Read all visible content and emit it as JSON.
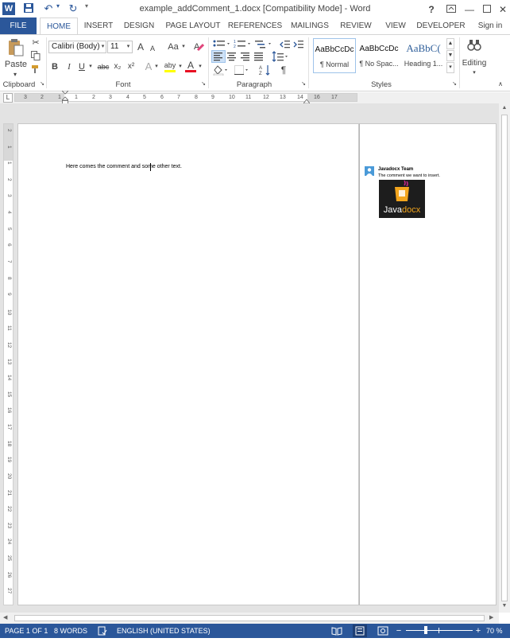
{
  "window": {
    "title": "example_addComment_1.docx [Compatibility Mode] - Word",
    "help": "?",
    "sign_in": "Sign in"
  },
  "tabs": [
    "FILE",
    "HOME",
    "INSERT",
    "DESIGN",
    "PAGE LAYOUT",
    "REFERENCES",
    "MAILINGS",
    "REVIEW",
    "VIEW",
    "DEVELOPER"
  ],
  "ribbon": {
    "clipboard": {
      "paste_label": "Paste",
      "group_label": "Clipboard"
    },
    "font": {
      "font_name": "Calibri (Body)",
      "font_size": "11",
      "group_label": "Font",
      "buttons": [
        "B",
        "I",
        "U",
        "abc",
        "x₂",
        "x²"
      ],
      "grow": "A",
      "shrink": "A",
      "case": "Aa",
      "effects": "A",
      "highlight": "aby",
      "color": "A",
      "colors": {
        "highlight": "#ffff00",
        "font_color": "#e81123"
      }
    },
    "paragraph": {
      "group_label": "Paragraph",
      "pilcrow": "¶"
    },
    "styles": {
      "group_label": "Styles",
      "items": [
        {
          "sample": "AaBbCcDc",
          "name": "¶ Normal"
        },
        {
          "sample": "AaBbCcDc",
          "name": "¶ No Spac..."
        },
        {
          "sample": "AaBbC(",
          "name": "Heading 1..."
        }
      ]
    },
    "editing": {
      "label": "Editing"
    }
  },
  "document": {
    "body_text": "Here comes the comment and some other text."
  },
  "comment": {
    "author": "Javadocx Team",
    "text": "The comment we want to insert.",
    "logo_text": "Java",
    "logo_text_accent": "docx"
  },
  "ruler": {
    "h_numbers": [
      "3",
      "2",
      "1",
      "1",
      "2",
      "3",
      "4",
      "5",
      "6",
      "7",
      "8",
      "9",
      "10",
      "11",
      "12",
      "13",
      "14",
      "16",
      "17"
    ],
    "v_numbers": [
      "2",
      "1",
      "1",
      "2",
      "3",
      "4",
      "5",
      "6",
      "7",
      "8",
      "9",
      "10",
      "11",
      "12",
      "13",
      "14",
      "15",
      "16",
      "17",
      "18",
      "19",
      "20",
      "21",
      "22",
      "23",
      "24",
      "25",
      "26",
      "27"
    ]
  },
  "status": {
    "page": "PAGE 1 OF 1",
    "words": "8 WORDS",
    "language": "ENGLISH (UNITED STATES)",
    "zoom": "70 %",
    "zoom_minus": "−",
    "zoom_plus": "+",
    "zoom_level": 0.3
  }
}
